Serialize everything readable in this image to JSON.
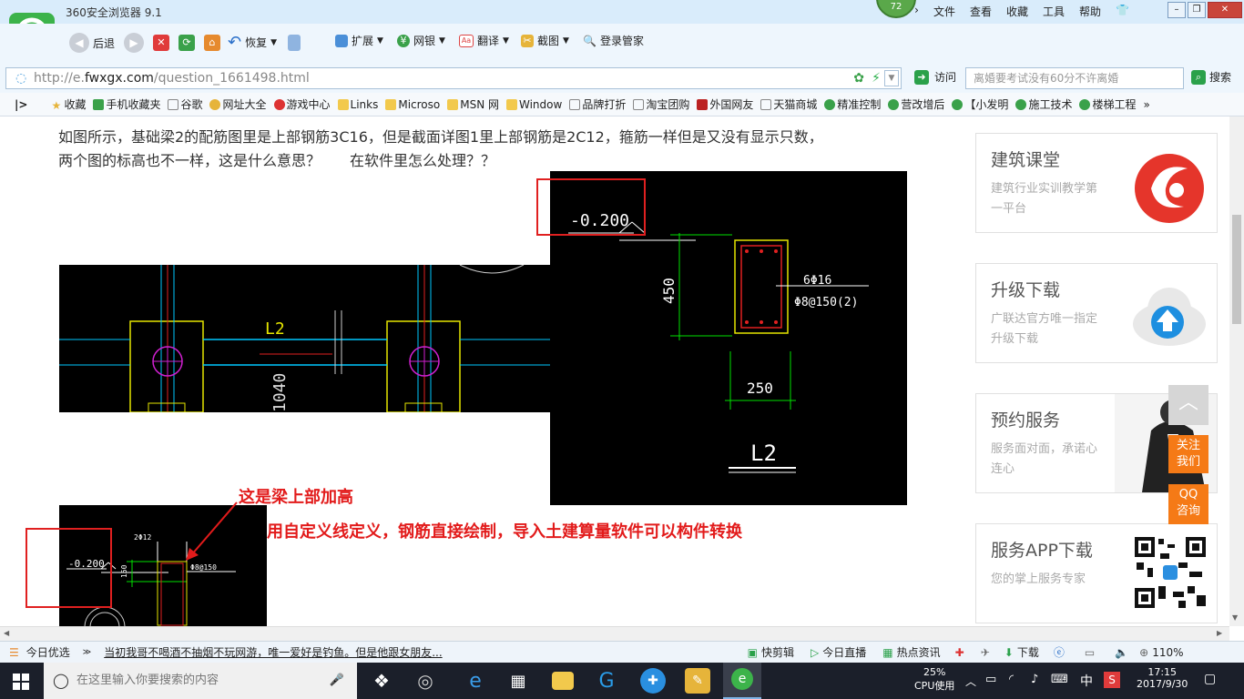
{
  "browser": {
    "title": "360安全浏览器 9.1",
    "badge": "72",
    "menu": [
      "文件",
      "查看",
      "收藏",
      "工具",
      "帮助"
    ],
    "back": "后退",
    "restore": "恢复",
    "ext": "扩展",
    "bank": "网银",
    "translate": "翻译",
    "screenshot": "截图",
    "login": "登录管家",
    "url_prefix": "http://e.",
    "url_domain": "fwxgx.com",
    "url_path": "/question_1661498.html",
    "visit": "访问",
    "search_placeholder": "离婚要考试没有60分不许离婚",
    "search_btn": "搜索"
  },
  "favorites": [
    "收藏",
    "手机收藏夹",
    "谷歌",
    "网址大全",
    "游戏中心",
    "Links",
    "Microso",
    "MSN 网",
    "Window",
    "品牌打折",
    "淘宝团购",
    "外国网友",
    "天猫商城",
    "精准控制",
    "营改增后",
    "【小发明",
    "施工技术",
    "楼梯工程"
  ],
  "question": {
    "text_line1": "如图所示，基础梁2的配筋图里是上部钢筋3C16，但是截面详图1里上部钢筋是2C12，箍筋一样但是又没有显示只数，",
    "text_line2": "两个图的标高也不一样，这是什么意思？　　在软件里怎么处理？？"
  },
  "cad": {
    "plan_beam": "L2",
    "plan_dim": "1040",
    "section_elev": "-0.200",
    "section_height": "450",
    "section_bars": "6Φ16",
    "section_stirrup": "Φ8@150(2)",
    "section_width": "250",
    "section_name": "L2",
    "small_elev": "-0.200",
    "small_top": "2Φ12",
    "small_height": "150",
    "small_stirrup": "Φ8@150"
  },
  "annotations": {
    "a1": "这是梁上部加高",
    "a2": "用自定义线定义，钢筋直接绘制，导入土建算量软件可以构件转换"
  },
  "sidebar": [
    {
      "title": "建筑课堂",
      "desc": "建筑行业实训教学第一平台"
    },
    {
      "title": "升级下载",
      "desc": "广联达官方唯一指定升级下载"
    },
    {
      "title": "预约服务",
      "desc": "服务面对面，承诺心连心"
    },
    {
      "title": "服务APP下载",
      "desc": "您的掌上服务专家"
    }
  ],
  "floating": {
    "contact": "关注我们",
    "qq": "QQ咨询"
  },
  "status": {
    "today": "今日优选",
    "news": "当初我哥不喝酒不抽烟不玩网游，唯一爱好是钓鱼。但是他跟女朋友...",
    "clip": "快剪辑",
    "live": "今日直播",
    "hot": "热点资讯",
    "download": "下载",
    "zoom": "110%"
  },
  "taskbar": {
    "search_placeholder": "在这里输入你要搜索的内容",
    "cpu": "25%",
    "cpu_label": "CPU使用",
    "ime": "中",
    "time": "17:15",
    "date": "2017/9/30"
  },
  "colors": {
    "accent": "#3cb34a",
    "annotation": "#e21b1b",
    "float": "#f57a16"
  }
}
